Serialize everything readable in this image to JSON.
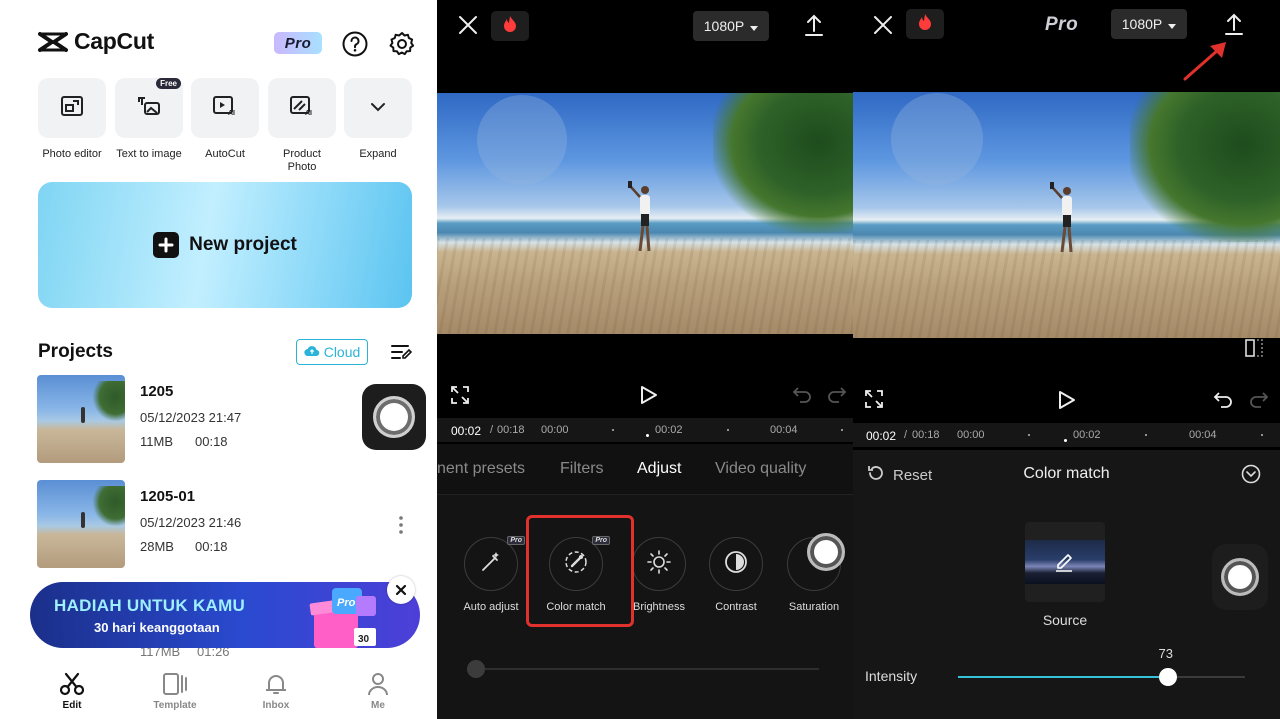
{
  "home": {
    "logo_text": "CapCut",
    "pro_badge": "Pro",
    "tools": [
      {
        "label": "Photo editor"
      },
      {
        "label": "Text to image",
        "badge": "Free"
      },
      {
        "label": "AutoCut"
      },
      {
        "label": "Product Photo"
      },
      {
        "label": "Expand"
      }
    ],
    "new_project_label": "New project",
    "projects_title": "Projects",
    "cloud_label": "Cloud",
    "projects": [
      {
        "name": "1205",
        "date": "05/12/2023 21:47",
        "size": "11MB",
        "duration": "00:18"
      },
      {
        "name": "1205-01",
        "date": "05/12/2023 21:46",
        "size": "28MB",
        "duration": "00:18"
      }
    ],
    "peek_row": {
      "size": "117MB",
      "duration": "01:26"
    },
    "promo": {
      "title": "HADIAH UNTUK KAMU",
      "subtitle": "30 hari keanggotaan",
      "art_pro": "Pro",
      "art_number": "30"
    },
    "nav": [
      {
        "label": "Edit",
        "active": true
      },
      {
        "label": "Template"
      },
      {
        "label": "Inbox"
      },
      {
        "label": "Me"
      }
    ]
  },
  "editor_adjust": {
    "resolution": "1080P",
    "time_current": "00:02",
    "time_total": "00:18",
    "ticks": [
      "00:00",
      "00:02",
      "00:04"
    ],
    "tabs": [
      {
        "label": "nent presets"
      },
      {
        "label": "Filters"
      },
      {
        "label": "Adjust",
        "active": true
      },
      {
        "label": "Video quality"
      }
    ],
    "pro_mini": "Pro",
    "tools": [
      {
        "label": "Auto adjust",
        "pro": true
      },
      {
        "label": "Color match",
        "pro": true,
        "highlighted": true
      },
      {
        "label": "Brightness"
      },
      {
        "label": "Contrast"
      },
      {
        "label": "Saturation"
      }
    ]
  },
  "editor_colormatch": {
    "pro_label": "Pro",
    "resolution": "1080P",
    "time_current": "00:02",
    "time_total": "00:18",
    "ticks": [
      "00:00",
      "00:02",
      "00:04"
    ],
    "reset_label": "Reset",
    "panel_title": "Color match",
    "source_label": "Source",
    "intensity_label": "Intensity",
    "intensity_value": 73,
    "intensity_value_text": "73"
  },
  "colors": {
    "accent_cyan": "#35c2d9",
    "highlight_red": "#e0312c",
    "arrow_red": "#e0312c"
  },
  "icons": [
    "logo-icon",
    "help-icon",
    "gear-icon",
    "photo-editor-icon",
    "text-to-image-icon",
    "autocut-icon",
    "product-photo-icon",
    "chevron-down-icon",
    "plus-icon",
    "cloud-icon",
    "sort-icon",
    "more-icon",
    "close-icon",
    "scissors-icon",
    "template-icon",
    "bell-icon",
    "person-icon",
    "flame-icon",
    "export-icon",
    "fullscreen-icon",
    "play-icon",
    "undo-icon",
    "redo-icon",
    "auto-adjust-icon",
    "color-match-icon",
    "brightness-icon",
    "contrast-icon",
    "saturation-icon",
    "reset-icon",
    "collapse-icon",
    "compare-icon",
    "edit-icon",
    "arrow-icon"
  ]
}
